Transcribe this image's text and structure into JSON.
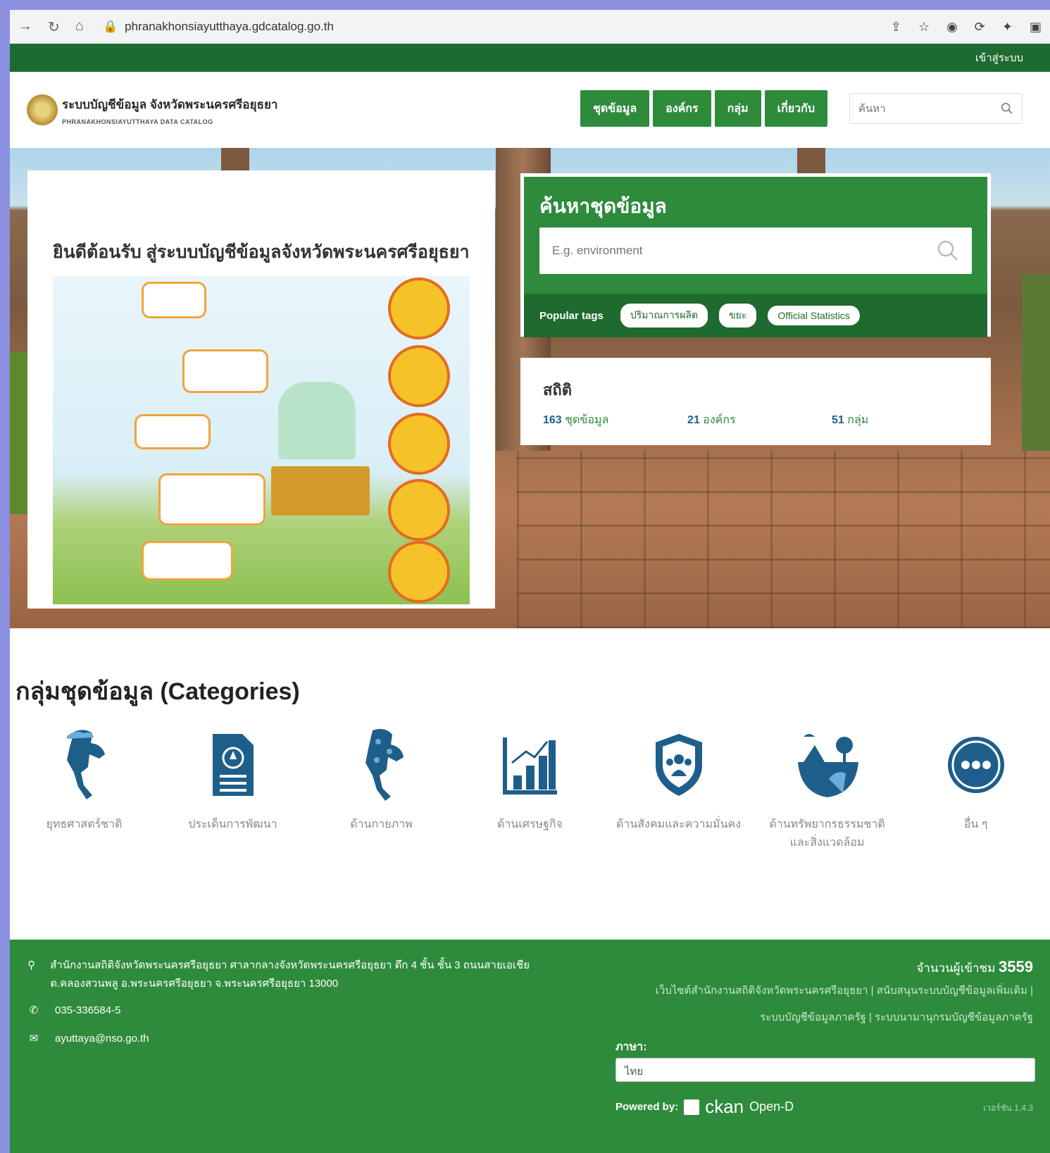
{
  "browser": {
    "url": "phranakhonsiayutthaya.gdcatalog.go.th"
  },
  "topbar": {
    "login_label": "เข้าสู่ระบบ"
  },
  "header": {
    "site_title_th": "ระบบบัญชีข้อมูล จังหวัดพระนครศรีอยุธยา",
    "site_title_en": "PHRANAKHONSIAYUTTHAYA DATA CATALOG",
    "menu": [
      "ชุดข้อมูล",
      "องค์กร",
      "กลุ่ม",
      "เกี่ยวกับ"
    ],
    "search_placeholder": "ค้นหา"
  },
  "welcome": {
    "title": "ยินดีต้อนรับ สู่ระบบบัญชีข้อมูลจังหวัดพระนครศรีอยุธยา"
  },
  "search": {
    "title": "ค้นหาชุดข้อมูล",
    "placeholder": "E.g. environment",
    "popular_label": "Popular tags",
    "tags": [
      "ปริมาณการผลิต",
      "ขยะ",
      "Official Statistics"
    ]
  },
  "stats": {
    "title": "สถิติ",
    "items": [
      {
        "count": "163",
        "label": "ชุดข้อมูล"
      },
      {
        "count": "21",
        "label": "องค์กร"
      },
      {
        "count": "51",
        "label": "กลุ่ม"
      }
    ]
  },
  "categories": {
    "title": "กลุ่มชุดข้อมูล (Categories)",
    "items": [
      {
        "label": "ยุทธศาสตร์ชาติ",
        "icon": "thailand-map-icon"
      },
      {
        "label": "ประเด็นการพัฒนา",
        "icon": "document-icon"
      },
      {
        "label": "ด้านกายภาพ",
        "icon": "map-pins-icon"
      },
      {
        "label": "ด้านเศรษฐกิจ",
        "icon": "bar-chart-icon"
      },
      {
        "label": "ด้านสังคมและความมั่นคง",
        "icon": "shield-people-icon"
      },
      {
        "label": "ด้านทรัพยากรธรรมชาติและสิ่งแวดล้อม",
        "icon": "nature-icon"
      },
      {
        "label": "อื่น ๆ",
        "icon": "more-icon"
      }
    ]
  },
  "footer": {
    "address": "สำนักงานสถิติจังหวัดพระนครศรีอยุธยา ศาลากลางจังหวัดพระนครศรีอยุธยา ตึก 4 ชั้น ชั้น 3 ถนนสายเอเชีย ต.คลองสวนพลู อ.พระนครศรีอยุธยา จ.พระนครศรีอยุธยา 13000",
    "phone": "035-336584-5",
    "email": "ayuttaya@nso.go.th",
    "visitor_label": "จำนวนผู้เข้าชม",
    "visitor_count": "3559",
    "links_line1": "เว็บไซต์สำนักงานสถิติจังหวัดพระนครศรีอยุธยา | สนับสนุนระบบบัญชีข้อมูลเพิ่มเติม |",
    "links_line2": "ระบบบัญชีข้อมูลภาครัฐ | ระบบนามานุกรมบัญชีข้อมูลภาครัฐ",
    "language_label": "ภาษา:",
    "language_value": "ไทย",
    "powered_label": "Powered by:",
    "ckan": "ckan",
    "opend": "Open-D",
    "version": "เวอร์ชัน 1.4.3"
  }
}
